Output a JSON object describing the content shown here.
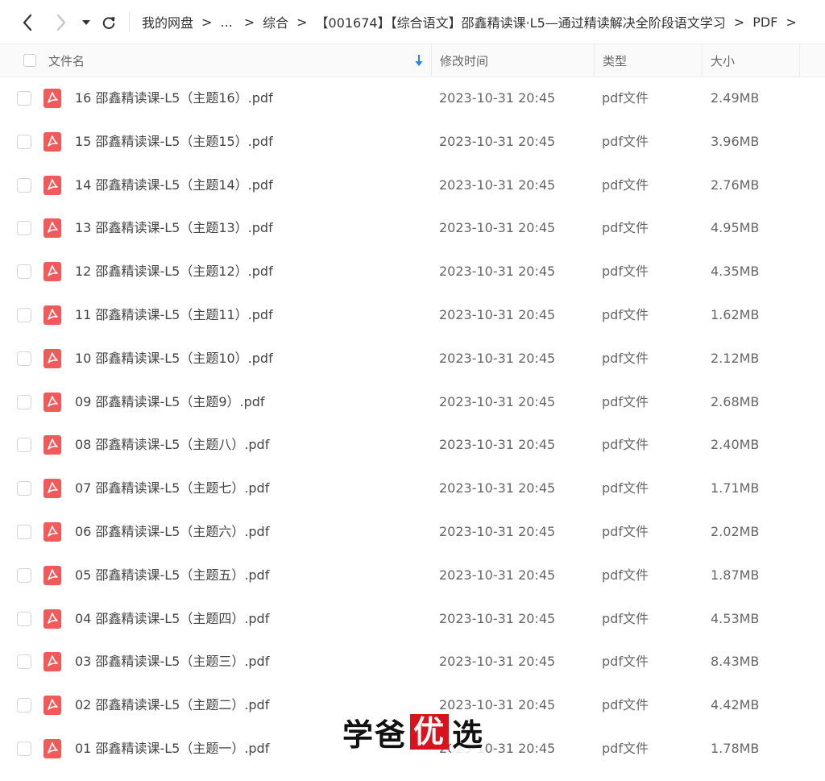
{
  "nav": {
    "breadcrumb": [
      {
        "label": "我的网盘"
      },
      {
        "label": "..."
      },
      {
        "label": "综合"
      },
      {
        "label": "【001674】【综合语文】邵鑫精读课·L5—通过精读解决全阶段语文学习"
      },
      {
        "label": "PDF"
      }
    ],
    "arrow": ">"
  },
  "columns": {
    "name": "文件名",
    "time": "修改时间",
    "type": "类型",
    "size": "大小"
  },
  "files": [
    {
      "name": "16 邵鑫精读课-L5（主题16）.pdf",
      "time": "2023-10-31 20:45",
      "type": "pdf文件",
      "size": "2.49MB"
    },
    {
      "name": "15 邵鑫精读课-L5（主题15）.pdf",
      "time": "2023-10-31 20:45",
      "type": "pdf文件",
      "size": "3.96MB"
    },
    {
      "name": "14 邵鑫精读课-L5（主题14）.pdf",
      "time": "2023-10-31 20:45",
      "type": "pdf文件",
      "size": "2.76MB"
    },
    {
      "name": "13 邵鑫精读课-L5（主题13）.pdf",
      "time": "2023-10-31 20:45",
      "type": "pdf文件",
      "size": "4.95MB"
    },
    {
      "name": "12 邵鑫精读课-L5（主题12）.pdf",
      "time": "2023-10-31 20:45",
      "type": "pdf文件",
      "size": "4.35MB"
    },
    {
      "name": "11 邵鑫精读课-L5（主题11）.pdf",
      "time": "2023-10-31 20:45",
      "type": "pdf文件",
      "size": "1.62MB"
    },
    {
      "name": "10 邵鑫精读课-L5（主题10）.pdf",
      "time": "2023-10-31 20:45",
      "type": "pdf文件",
      "size": "2.12MB"
    },
    {
      "name": "09 邵鑫精读课-L5（主题9）.pdf",
      "time": "2023-10-31 20:45",
      "type": "pdf文件",
      "size": "2.68MB"
    },
    {
      "name": "08 邵鑫精读课-L5（主题八）.pdf",
      "time": "2023-10-31 20:45",
      "type": "pdf文件",
      "size": "2.40MB"
    },
    {
      "name": "07 邵鑫精读课-L5（主题七）.pdf",
      "time": "2023-10-31 20:45",
      "type": "pdf文件",
      "size": "1.71MB"
    },
    {
      "name": "06 邵鑫精读课-L5（主题六）.pdf",
      "time": "2023-10-31 20:45",
      "type": "pdf文件",
      "size": "2.02MB"
    },
    {
      "name": "05 邵鑫精读课-L5（主题五）.pdf",
      "time": "2023-10-31 20:45",
      "type": "pdf文件",
      "size": "1.87MB"
    },
    {
      "name": "04 邵鑫精读课-L5（主题四）.pdf",
      "time": "2023-10-31 20:45",
      "type": "pdf文件",
      "size": "4.53MB"
    },
    {
      "name": "03 邵鑫精读课-L5（主题三）.pdf",
      "time": "2023-10-31 20:45",
      "type": "pdf文件",
      "size": "8.43MB"
    },
    {
      "name": "02 邵鑫精读课-L5（主题二）.pdf",
      "time": "2023-10-31 20:45",
      "type": "pdf文件",
      "size": "4.42MB"
    },
    {
      "name": "01 邵鑫精读课-L5（主题一）.pdf",
      "time": "2023-10-31 20:45",
      "type": "pdf文件",
      "size": "1.78MB"
    }
  ],
  "watermark": {
    "part1": "学爸",
    "part2": "优",
    "part3": "选"
  },
  "colors": {
    "pdf_icon": "#f05a5a",
    "sort_icon": "#1a8cff",
    "watermark_red": "#d8131d"
  },
  "icons": {
    "back": "chevron-left-icon",
    "forward": "chevron-right-icon",
    "history": "caret-down-icon",
    "refresh": "refresh-icon",
    "sort": "sort-down-arrow-icon",
    "file": "pdf-file-icon"
  }
}
